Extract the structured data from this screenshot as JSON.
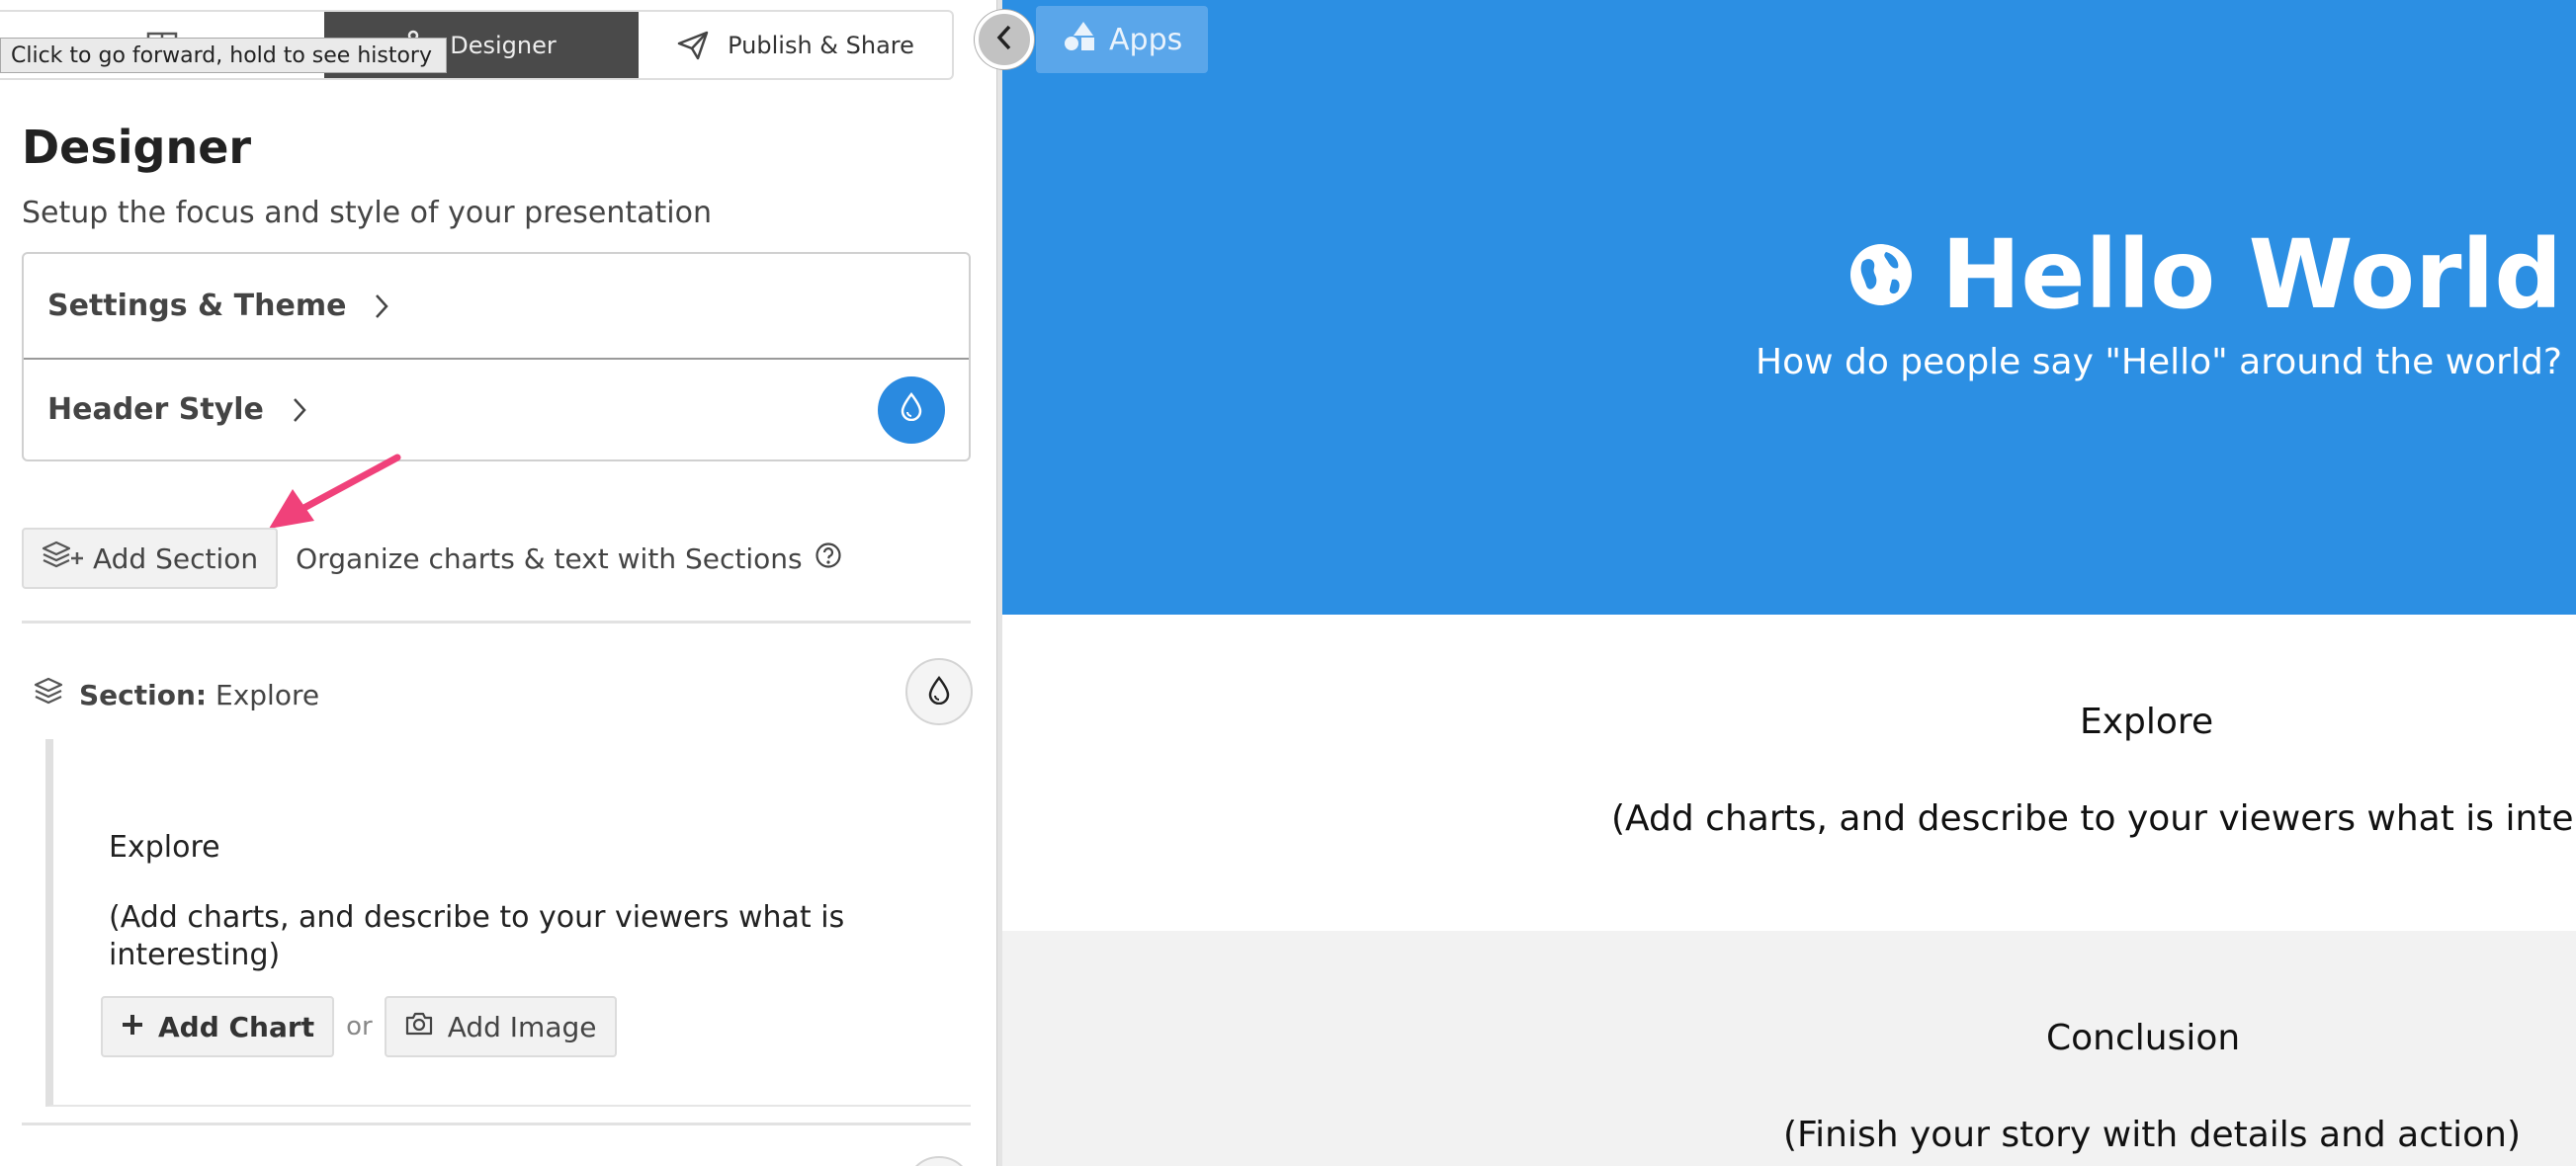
{
  "tooltip": "Click to go forward, hold to see history",
  "tabs": {
    "designer": "Designer",
    "publish": "Publish & Share"
  },
  "designer": {
    "title": "Designer",
    "subtitle": "Setup the focus and style of your presentation",
    "settings_theme": "Settings & Theme",
    "header_style": "Header Style"
  },
  "add_section": {
    "label": "Add Section",
    "hint": "Organize charts & text with Sections"
  },
  "section": {
    "prefix": "Section:",
    "name": "Explore",
    "body_title": "Explore",
    "body_desc": "(Add charts, and describe to your viewers what is interesting)",
    "add_chart": "Add Chart",
    "or": "or",
    "add_image": "Add Image"
  },
  "preview": {
    "apps": "Apps",
    "title": "Hello World",
    "subtitle": "How do people say \"Hello\" around the world?",
    "explore_title": "Explore",
    "explore_desc": "(Add charts, and describe to your viewers what is interesting)",
    "conclusion_title": "Conclusion",
    "conclusion_desc": "(Finish your story with details and action)"
  },
  "colors": {
    "hero": "#2c8fe3",
    "accent_button": "#2a8ae0",
    "arrow": "#f0417a"
  }
}
